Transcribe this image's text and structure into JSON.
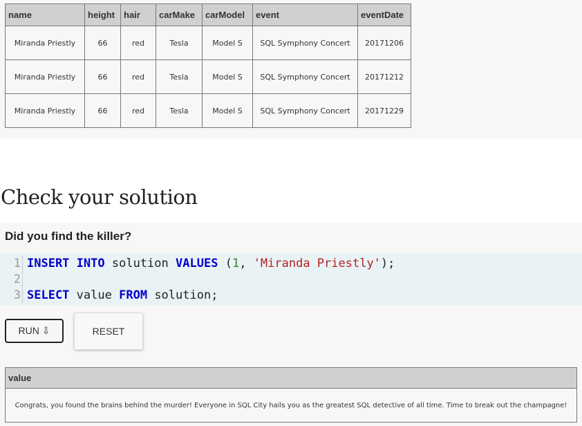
{
  "results_table": {
    "headers": [
      "name",
      "height",
      "hair",
      "carMake",
      "carModel",
      "event",
      "eventDate"
    ],
    "rows": [
      [
        "Miranda Priestly",
        "66",
        "red",
        "Tesla",
        "Model S",
        "SQL Symphony Concert",
        "20171206"
      ],
      [
        "Miranda Priestly",
        "66",
        "red",
        "Tesla",
        "Model S",
        "SQL Symphony Concert",
        "20171212"
      ],
      [
        "Miranda Priestly",
        "66",
        "red",
        "Tesla",
        "Model S",
        "SQL Symphony Concert",
        "20171229"
      ]
    ]
  },
  "section_title": "Check your solution",
  "question": "Did you find the killer?",
  "editor": {
    "line_numbers": [
      "1",
      "2",
      "3"
    ],
    "line1": {
      "kw1": "INSERT",
      "kw2": "INTO",
      "ident": "solution",
      "kw3": "VALUES",
      "open": "(",
      "num": "1",
      "comma": ",",
      "str": "'Miranda Priestly'",
      "close": ");"
    },
    "line3": {
      "kw1": "SELECT",
      "ident1": "value",
      "kw2": "FROM",
      "ident2": "solution;"
    }
  },
  "buttons": {
    "run_label": "RUN ⇩",
    "reset_label": "RESET"
  },
  "output_table": {
    "header": "value",
    "cell": "Congrats, you found the brains behind the murder! Everyone in SQL City hails you as the greatest SQL detective of all time. Time to break out the champagne!"
  },
  "colors": {
    "editor_bg": "#e9f2f5",
    "keyword": "#0000cc",
    "number": "#2a8a2a",
    "string": "#b22222",
    "table_header": "#d0d0d0"
  }
}
